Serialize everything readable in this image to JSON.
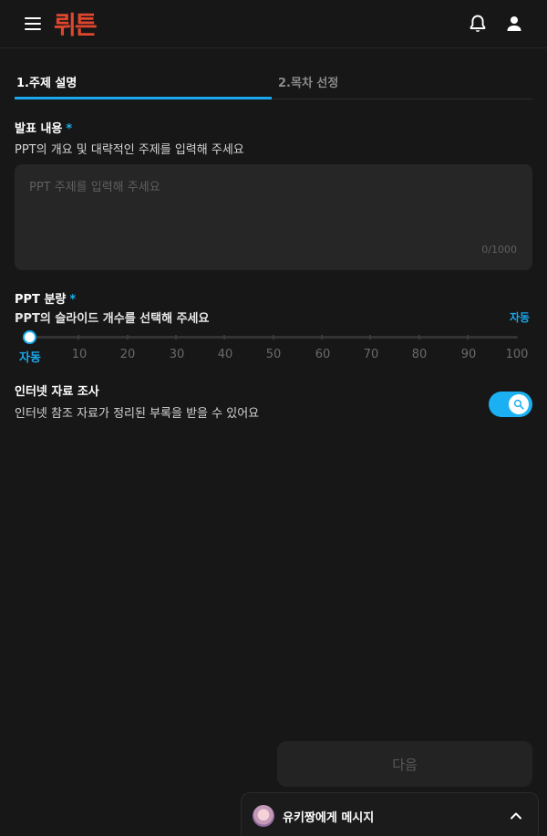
{
  "header": {
    "logo_text": "뤼튼",
    "logo_color": "#e0462e",
    "icons": [
      "menu-icon",
      "bell-icon",
      "user-icon"
    ]
  },
  "tabs": [
    {
      "label": "1.주제 설명",
      "active": true
    },
    {
      "label": "2.목차 선정",
      "active": false
    }
  ],
  "topic": {
    "title": "발표 내용",
    "required_mark": "*",
    "description": "PPT의 개요 및 대략적인 주제를 입력해 주세요",
    "placeholder": "PPT 주제를 입력해 주세요",
    "value": "",
    "counter": "0/1000"
  },
  "volume": {
    "title": "PPT 분량",
    "required_mark": "*",
    "description": "PPT의 슬라이드 개수를 선택해 주세요",
    "current_value_label": "자동",
    "slider_labels": [
      "자동",
      "10",
      "20",
      "30",
      "40",
      "50",
      "60",
      "70",
      "80",
      "90",
      "100"
    ],
    "selected_index": 0
  },
  "internet_research": {
    "title": "인터넷 자료 조사",
    "description": "인터넷 참조 자료가 정리된 부록을 받을 수 있어요",
    "enabled": true
  },
  "next_button": {
    "label": "다음",
    "enabled": false
  },
  "chat": {
    "label": "유키짱에게 메시지",
    "icon": "chevron-up-icon"
  },
  "colors": {
    "accent": "#1ab0f2",
    "background": "#171717",
    "input_background": "#262626",
    "logo": "#e0462e"
  }
}
